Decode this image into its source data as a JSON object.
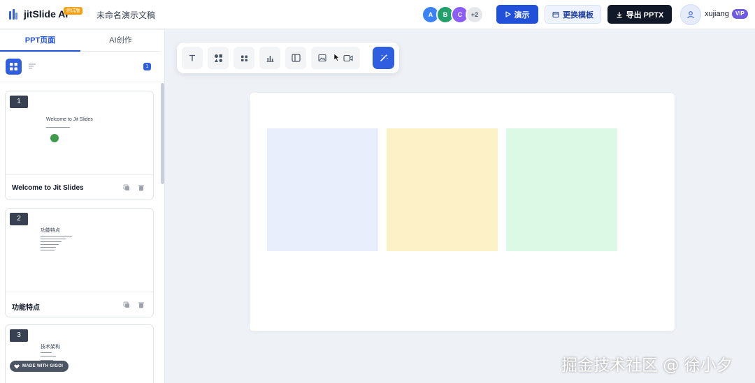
{
  "header": {
    "app_name": "jitSlide AI",
    "beta_badge": "测试版",
    "doc_title": "未命名演示文稿",
    "collaborators": [
      {
        "initial": "A",
        "color": "#3b82f6"
      },
      {
        "initial": "B",
        "color": "#22a06b"
      },
      {
        "initial": "C",
        "color": "#8b5cf6"
      },
      {
        "initial": "+2",
        "color": "#e5e7eb"
      }
    ],
    "present_label": "演示",
    "template_label": "更换模板",
    "export_label": "导出 PPTX",
    "username": "xujiang",
    "vip_label": "VIP"
  },
  "sidebar": {
    "tabs": [
      {
        "label": "PPT页面"
      },
      {
        "label": "AI创作"
      }
    ],
    "slide_count": "1",
    "slides": [
      {
        "number": "1",
        "title": "Welcome to Jit Slides",
        "preview_heading": "Welcome to Jit Slides"
      },
      {
        "number": "2",
        "title": "功能特点",
        "preview_heading": "功能特点"
      },
      {
        "number": "3",
        "title": "",
        "preview_heading": "技术架构"
      }
    ],
    "made_with": "MADE WITH GIGOI"
  },
  "toolbar": {
    "tools": [
      {
        "icon": "text-icon"
      },
      {
        "icon": "shapes-icon"
      },
      {
        "icon": "components-icon"
      },
      {
        "icon": "chart-icon"
      },
      {
        "icon": "layout-icon"
      },
      {
        "icon": "image-icon"
      },
      {
        "icon": "video-icon"
      },
      {
        "icon": "magic-wand-icon"
      }
    ]
  },
  "canvas": {
    "boxes": [
      {
        "color": "#e8eefb"
      },
      {
        "color": "#fdf1c7"
      },
      {
        "color": "#dcf9e5"
      }
    ]
  },
  "watermark": "掘金技术社区 @ 徐小夕"
}
